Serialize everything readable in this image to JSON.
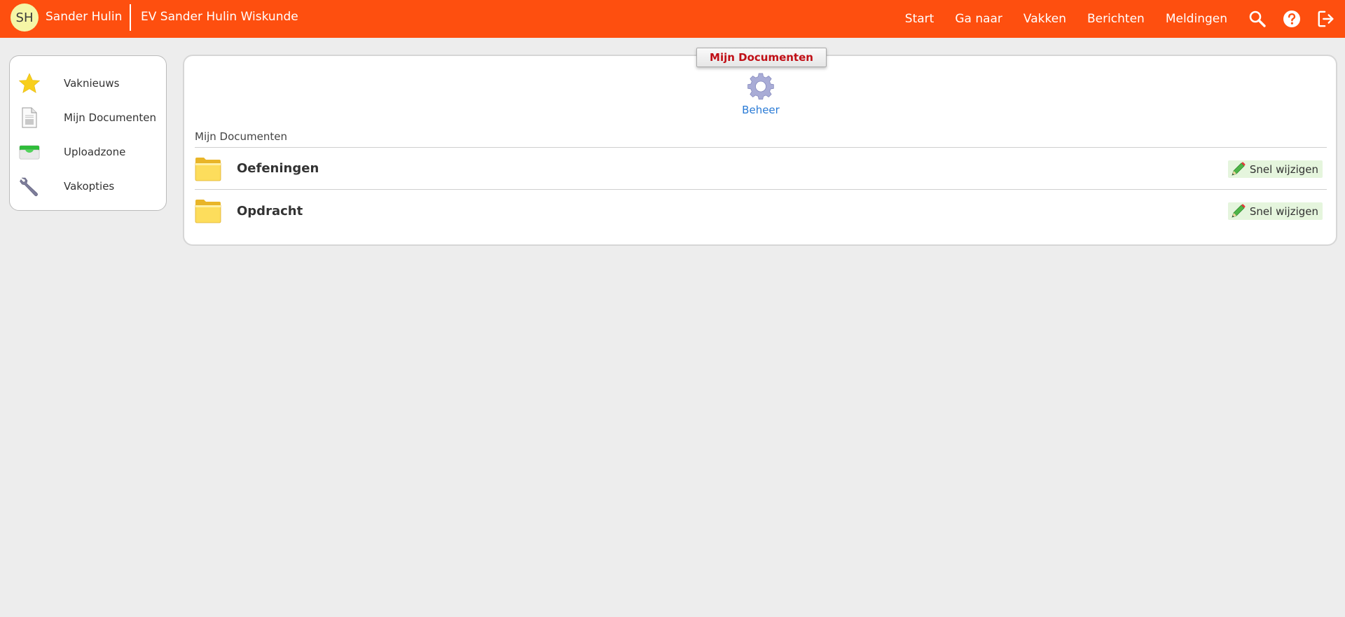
{
  "header": {
    "avatar_initials": "SH",
    "user_name": "Sander Hulin",
    "course_title": "EV Sander Hulin Wiskunde",
    "nav": [
      "Start",
      "Ga naar",
      "Vakken",
      "Berichten",
      "Meldingen"
    ],
    "icons": [
      "search-icon",
      "help-icon",
      "logout-icon"
    ],
    "color": "#fe4f0f"
  },
  "sidebar": {
    "items": [
      {
        "label": "Vaknieuws",
        "icon": "star-icon"
      },
      {
        "label": "Mijn Documenten",
        "icon": "document-icon"
      },
      {
        "label": "Uploadzone",
        "icon": "inbox-icon"
      },
      {
        "label": "Vakopties",
        "icon": "wrench-icon"
      }
    ]
  },
  "main": {
    "tab_title": "Mijn Documenten",
    "beheer_label": "Beheer",
    "section_title": "Mijn Documenten",
    "folders": [
      {
        "name": "Oefeningen",
        "action": "Snel wijzigen"
      },
      {
        "name": "Opdracht",
        "action": "Snel wijzigen"
      }
    ]
  }
}
